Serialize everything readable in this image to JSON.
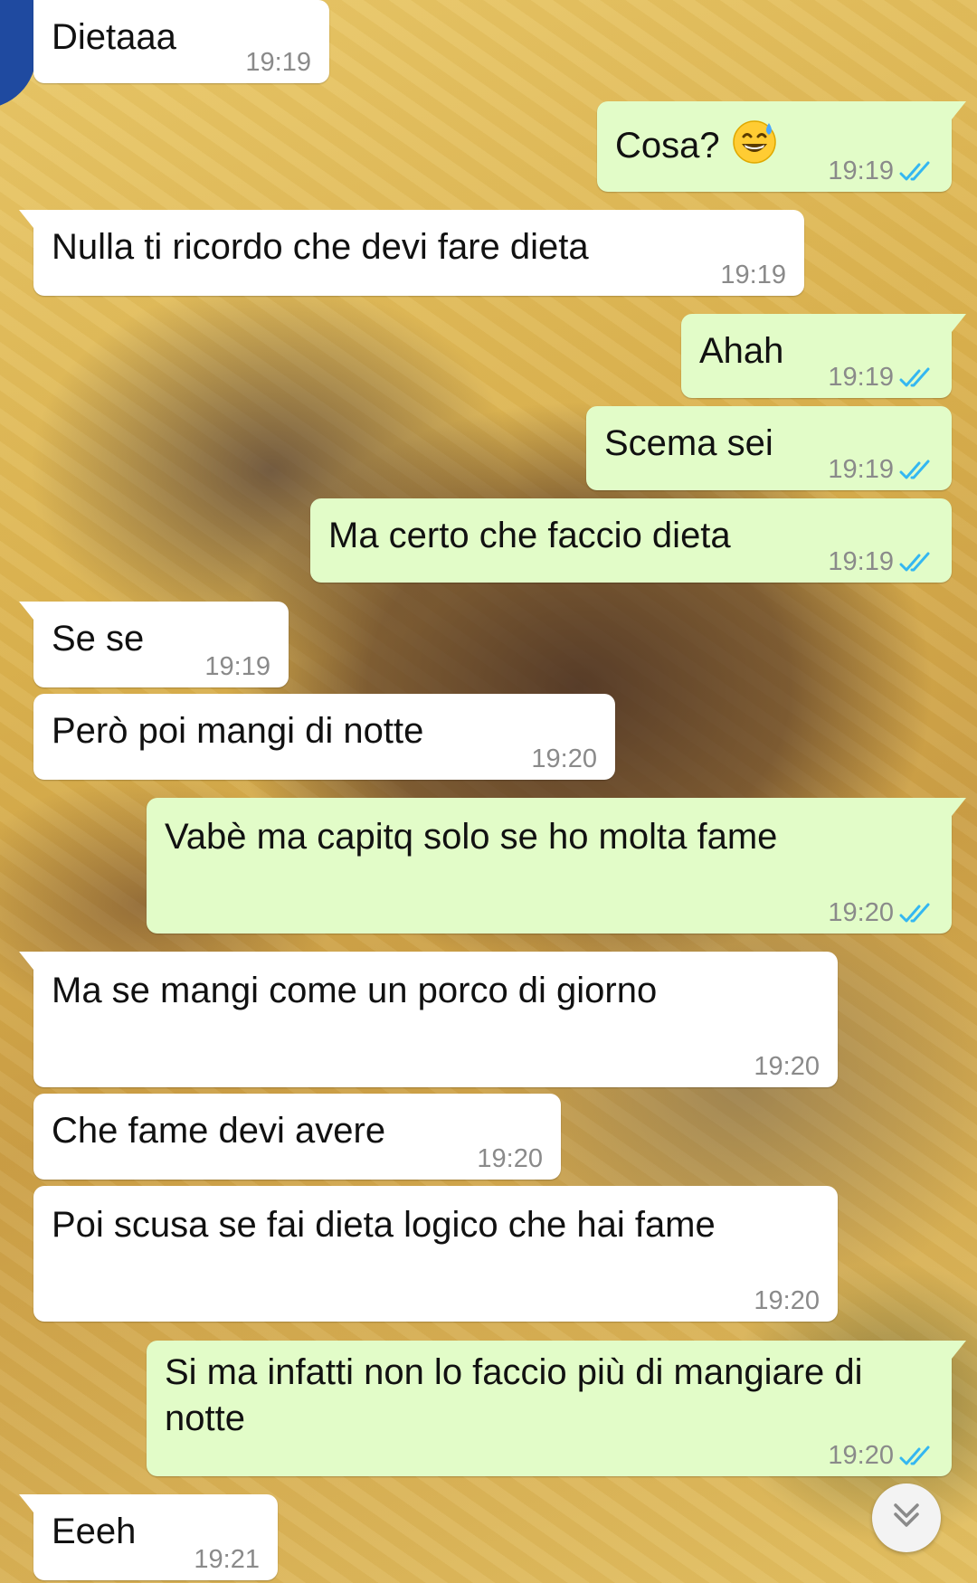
{
  "colors": {
    "incoming_bubble": "#ffffff",
    "outgoing_bubble": "#e2fcc8",
    "timestamp": "#8a8a8a",
    "read_ticks": "#34b7f1"
  },
  "messages": [
    {
      "direction": "incoming",
      "text": "Dietaaa",
      "time": "19:19"
    },
    {
      "direction": "outgoing",
      "text": "Cosa?",
      "emoji": "grinning-face-with-sweat",
      "time": "19:19",
      "status": "read"
    },
    {
      "direction": "incoming",
      "text": "Nulla ti ricordo che devi fare dieta",
      "time": "19:19"
    },
    {
      "direction": "outgoing",
      "text": "Ahah",
      "time": "19:19",
      "status": "read"
    },
    {
      "direction": "outgoing",
      "text": "Scema sei",
      "time": "19:19",
      "status": "read"
    },
    {
      "direction": "outgoing",
      "text": "Ma certo che faccio dieta",
      "time": "19:19",
      "status": "read"
    },
    {
      "direction": "incoming",
      "text": "Se se",
      "time": "19:19"
    },
    {
      "direction": "incoming",
      "text": "Però poi mangi di notte",
      "time": "19:20"
    },
    {
      "direction": "outgoing",
      "text": "Vabè ma capitq solo se ho molta fame",
      "time": "19:20",
      "status": "read"
    },
    {
      "direction": "incoming",
      "text": "Ma se mangi come un porco di giorno",
      "time": "19:20"
    },
    {
      "direction": "incoming",
      "text": "Che fame devi avere",
      "time": "19:20"
    },
    {
      "direction": "incoming",
      "text": "Poi scusa se fai dieta logico che hai fame",
      "time": "19:20"
    },
    {
      "direction": "outgoing",
      "text": "Si ma infatti non lo faccio più di mangiare di notte",
      "time": "19:20",
      "status": "read"
    },
    {
      "direction": "incoming",
      "text": "Eeeh",
      "time": "19:21"
    }
  ],
  "scroll_button": {
    "icon": "double-chevron-down-icon"
  }
}
